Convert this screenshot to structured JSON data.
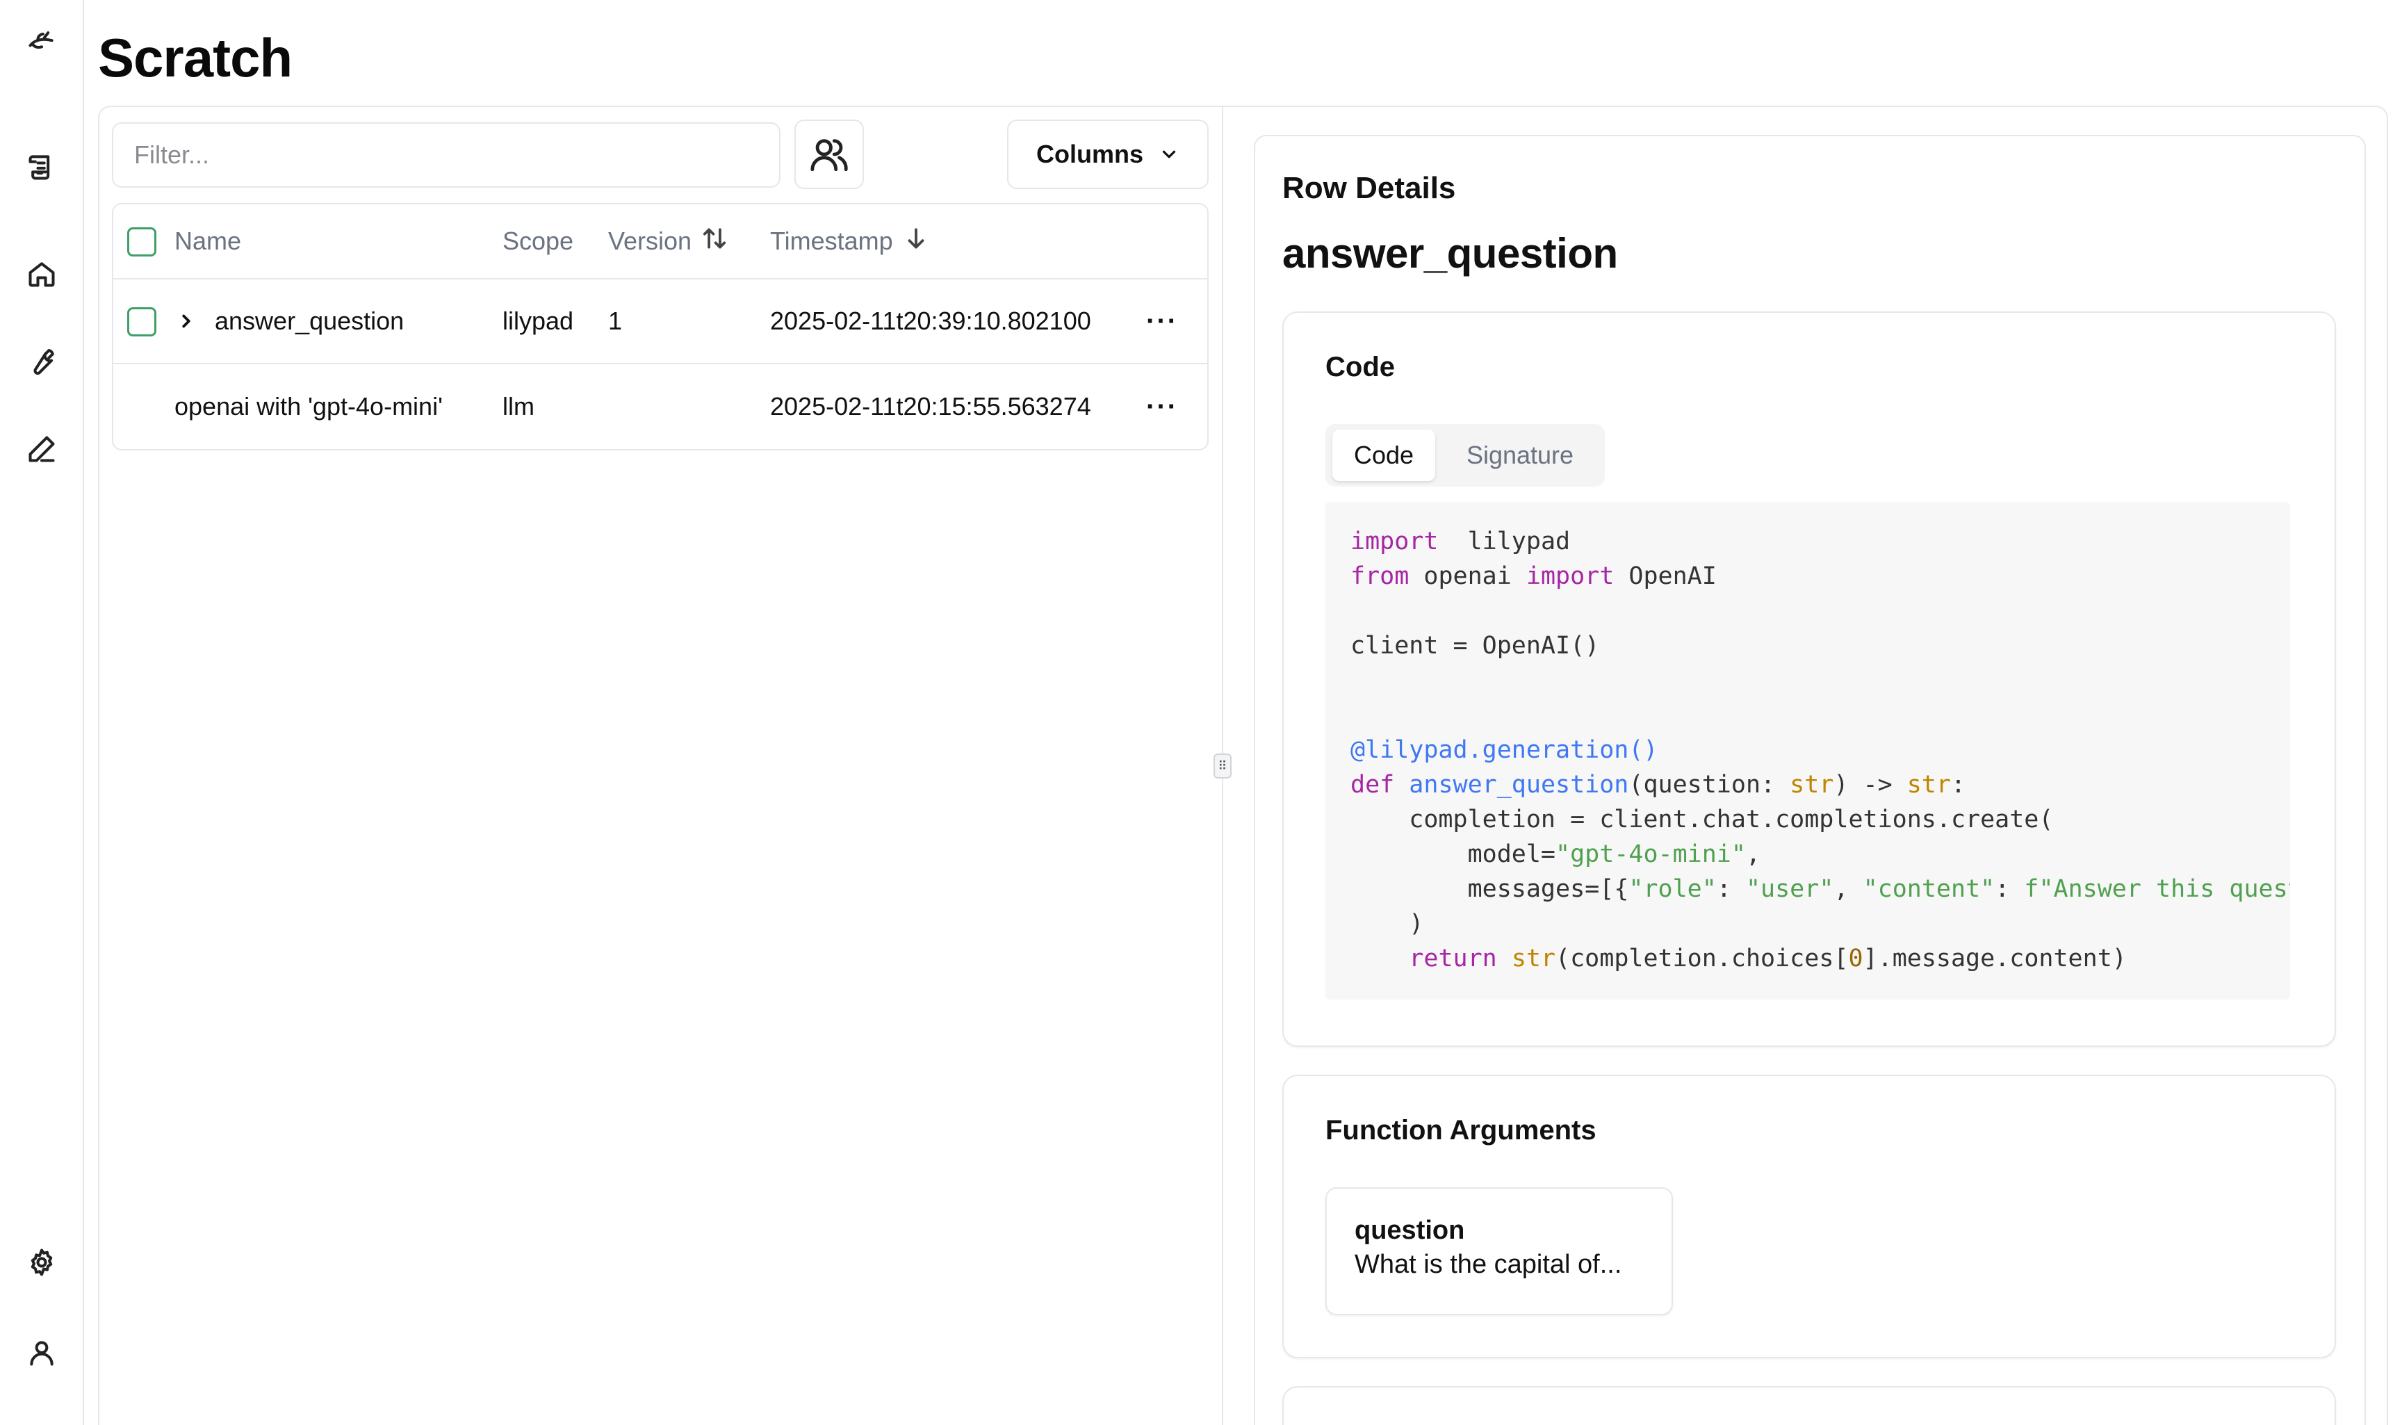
{
  "page": {
    "title": "Scratch"
  },
  "sidebar": {
    "icons": [
      "logo-icon",
      "traces-icon",
      "home-icon",
      "wrench-icon",
      "pencil-icon",
      "settings-icon",
      "user-icon"
    ]
  },
  "toolbar": {
    "filter_placeholder": "Filter...",
    "filter_value": "",
    "columns_label": "Columns"
  },
  "table": {
    "headers": {
      "name": "Name",
      "scope": "Scope",
      "version": "Version",
      "timestamp": "Timestamp"
    },
    "rows": [
      {
        "name": "answer_question",
        "scope": "lilypad",
        "version": "1",
        "timestamp": "2025-02-11t20:39:10.802100",
        "actions": "···"
      },
      {
        "name": "openai with 'gpt-4o-mini'",
        "scope": "llm",
        "version": "",
        "timestamp": "2025-02-11t20:15:55.563274",
        "actions": "···"
      }
    ]
  },
  "details": {
    "section_label": "Row Details",
    "function_name": "answer_question",
    "code_card": {
      "title": "Code",
      "tabs": [
        "Code",
        "Signature"
      ],
      "active_tab": "Code"
    },
    "args_card": {
      "title": "Function Arguments",
      "args": [
        {
          "name": "question",
          "value": "What is the capital of..."
        }
      ]
    }
  },
  "code_lines": [
    [
      [
        "kw",
        "import"
      ],
      [
        "",
        "  lilypad"
      ]
    ],
    [
      [
        "kw",
        "from"
      ],
      [
        "",
        " openai "
      ],
      [
        "kw",
        "import"
      ],
      [
        "",
        " OpenAI"
      ]
    ],
    [],
    [
      [
        "",
        "client = OpenAI()"
      ]
    ],
    [],
    [],
    [
      [
        "dec",
        "@lilypad.generation()"
      ]
    ],
    [
      [
        "kw",
        "def"
      ],
      [
        "",
        " "
      ],
      [
        "fn",
        "answer_question"
      ],
      [
        "",
        "(question: "
      ],
      [
        "bi",
        "str"
      ],
      [
        "",
        ") -> "
      ],
      [
        "bi",
        "str"
      ],
      [
        "",
        ":"
      ]
    ],
    [
      [
        "",
        "    completion = client.chat.completions.create("
      ]
    ],
    [
      [
        "",
        "        model="
      ],
      [
        "st",
        "\"gpt-4o-mini\""
      ],
      [
        "",
        ","
      ]
    ],
    [
      [
        "",
        "        messages=[{"
      ],
      [
        "st",
        "\"role\""
      ],
      [
        "",
        ": "
      ],
      [
        "st",
        "\"user\""
      ],
      [
        "",
        ", "
      ],
      [
        "st",
        "\"content\""
      ],
      [
        "",
        ": "
      ],
      [
        "st",
        "f\"Answer this question: {question}\""
      ],
      [
        "",
        "}],"
      ]
    ],
    [
      [
        "",
        "    )"
      ]
    ],
    [
      [
        "",
        "    "
      ],
      [
        "kw",
        "return"
      ],
      [
        "",
        " "
      ],
      [
        "bi",
        "str"
      ],
      [
        "",
        "(completion.choices["
      ],
      [
        "nm",
        "0"
      ],
      [
        "",
        "].message.content)"
      ]
    ]
  ],
  "colors": {
    "checkbox_border": "#3f9f67",
    "keyword": "#a626a4",
    "decorator": "#4078f2",
    "builtin": "#c18401",
    "string": "#50a14f",
    "number": "#986801"
  }
}
